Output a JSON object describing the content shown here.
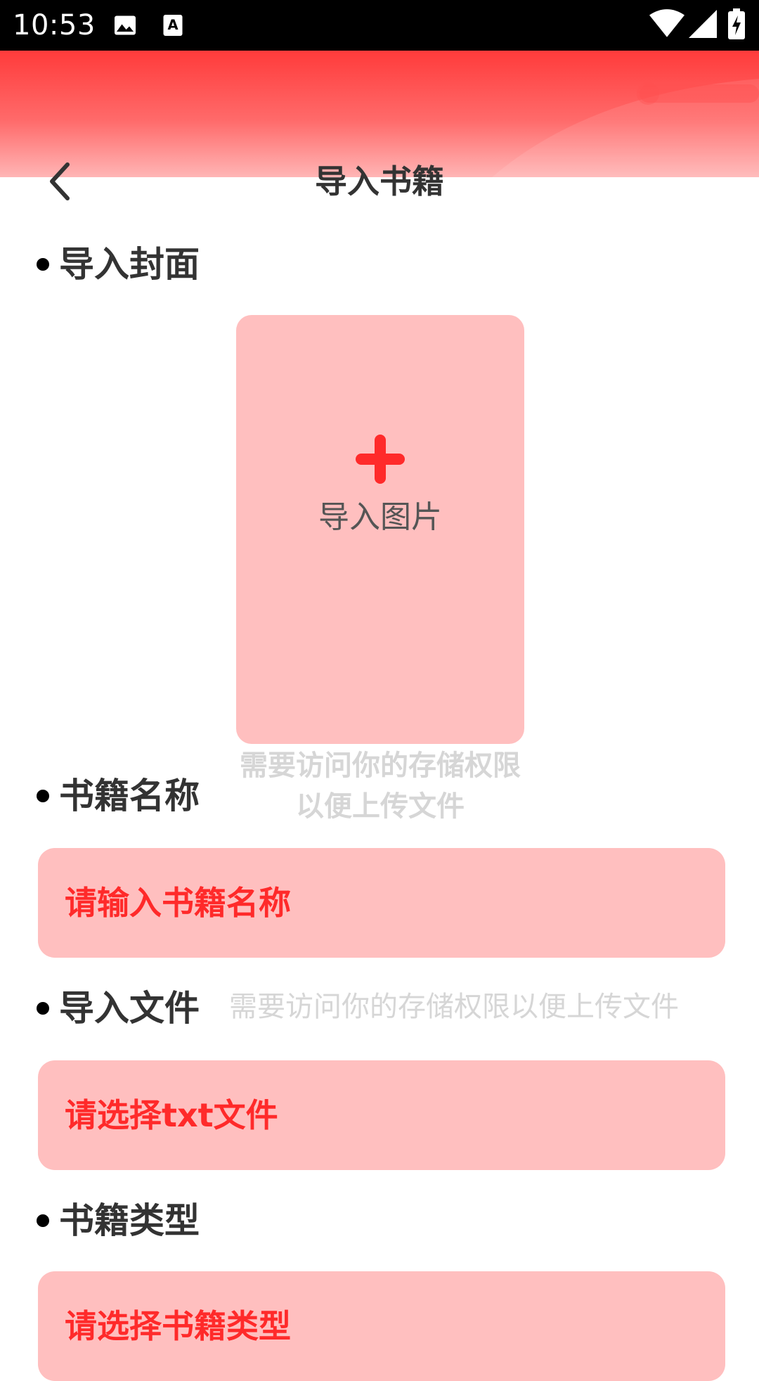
{
  "status_bar": {
    "time": "10:53",
    "left_icons": [
      "image-icon",
      "text-notification-icon"
    ],
    "right_icons": [
      "wifi-icon",
      "cellular-signal-icon",
      "battery-charging-icon"
    ]
  },
  "header": {
    "title": "导入书籍",
    "back_icon": "chevron-left-icon"
  },
  "cover_section": {
    "heading": "导入封面",
    "upload_label": "导入图片",
    "upload_icon": "plus-icon",
    "hint": "需要访问你的存储权限以便上传文件"
  },
  "name_section": {
    "heading": "书籍名称",
    "placeholder": "请输入书籍名称"
  },
  "file_section": {
    "heading": "导入文件",
    "hint": "需要访问你的存储权限以便上传文件",
    "placeholder": "请选择txt文件"
  },
  "type_section": {
    "heading": "书籍类型",
    "placeholder": "请选择书籍类型"
  },
  "colors": {
    "header_red": "#ff3b3b",
    "field_pink": "#ffbfbf",
    "accent_red": "#ff2a2a",
    "hint_gray": "#d6d6d6"
  }
}
